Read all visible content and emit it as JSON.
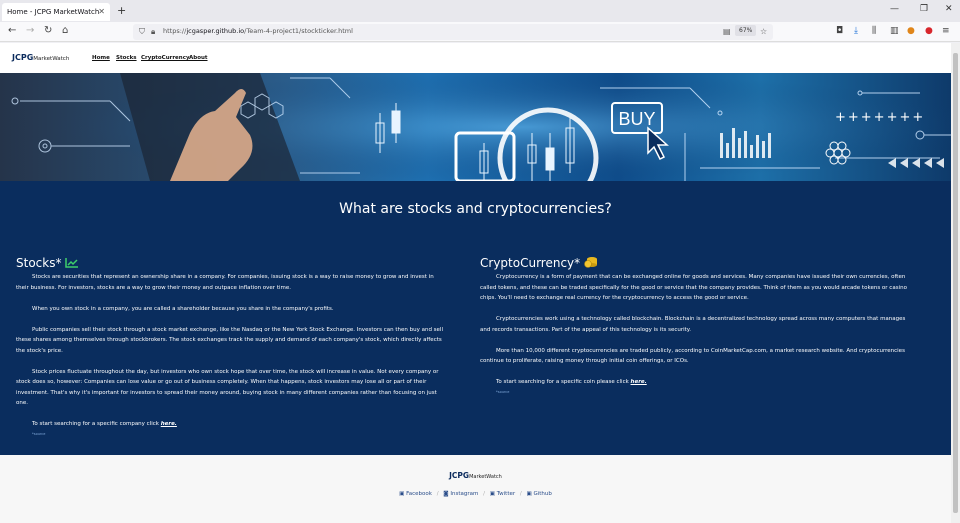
{
  "browser": {
    "tab_title": "Home - JCPG MarketWatch",
    "url_prefix": "https://",
    "url_domain": "jcgasper.github.io",
    "url_path": "/Team-4-project1/stockticker.html",
    "zoom": "67%"
  },
  "site": {
    "logo_main": "JCPG",
    "logo_sub": "MarketWatch",
    "nav": [
      "Home",
      "Stocks",
      "CryptoCurrency",
      "About"
    ],
    "headline": "What are stocks and cryptocurrencies?",
    "hero_buy": "BUY",
    "stocks": {
      "title": "Stocks*",
      "p1": "Stocks are securities that represent an ownership share in a company. For companies, issuing stock is a way to raise money to grow and invest in their business. For investors, stocks are a way to grow their money and outpace inflation over time.",
      "p2": "When you own stock in a company, you are called a shareholder because you share in the company's profits.",
      "p3": "Public companies sell their stock through a stock market exchange, like the Nasdaq or the New York Stock Exchange. Investors can then buy and sell these shares among themselves through stockbrokers. The stock exchanges track the supply and demand of each company's stock, which directly affects the stock's price.",
      "p4": "Stock prices fluctuate throughout the day, but investors who own stock hope that over time, the stock will increase in value. Not every company or stock does so, however: Companies can lose value or go out of business completely. When that happens, stock investors may lose all or part of their investment. That's why it's important for investors to spread their money around, buying stock in many different companies rather than focusing on just one.",
      "cta": "To start searching for a specific company click",
      "link": "here.",
      "source": "*source"
    },
    "crypto": {
      "title": "CryptoCurrency*",
      "p1": "Cryptocurrency is a form of payment that can be exchanged online for goods and services. Many companies have issued their own currencies, often called tokens, and these can be traded specifically for the good or service that the company provides. Think of them as you would arcade tokens or casino chips. You'll need to exchange real currency for the cryptocurrency to access the good or service.",
      "p2": "Cryptocurrencies work using a technology called blockchain. Blockchain is a decentralized technology spread across many computers that manages and records transactions. Part of the appeal of this technology is its security.",
      "p3": "More than 10,000 different cryptocurrencies are traded publicly, according to CoinMarketCap.com, a market research website. And cryptocurrencies continue to proliferate, raising money through initial coin offerings, or ICOs.",
      "cta": "To start searching for a specific coin please click",
      "link": "here.",
      "source": "*source"
    },
    "footer": {
      "links": [
        "Facebook",
        "Instagram",
        "Twitter",
        "Github"
      ]
    }
  },
  "colors": {
    "main_bg": "#0a2d5e",
    "accent_green": "#3ecf6a",
    "coin_gold": "#e8b820"
  }
}
